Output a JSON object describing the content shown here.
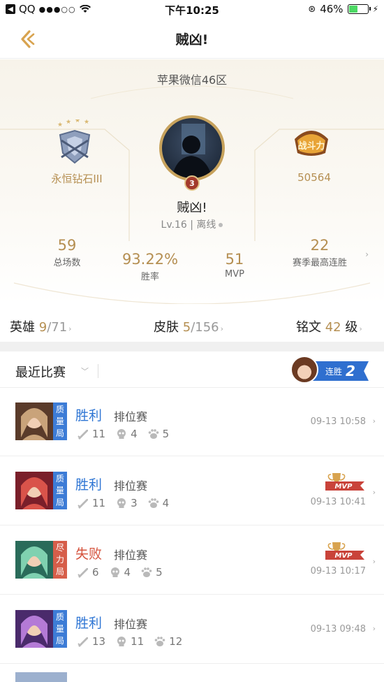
{
  "status": {
    "carrier": "QQ",
    "time": "下午10:25",
    "battery": "46%",
    "battery_level": 0.46
  },
  "nav": {
    "title": "贼凶!"
  },
  "profile": {
    "server": "苹果微信46区",
    "rank": "永恒钻石III",
    "combat_power": "50564",
    "name": "贼凶!",
    "level_text": "Lv.16 | 离线",
    "avatar_badge": "3",
    "stats": [
      {
        "num": "59",
        "label": "总场数"
      },
      {
        "num": "93.22%",
        "label": "胜率"
      },
      {
        "num": "51",
        "label": "MVP"
      },
      {
        "num": "22",
        "label": "赛季最高连胜"
      }
    ]
  },
  "summary": {
    "heroes_label": "英雄",
    "heroes_owned": "9",
    "heroes_total": "/71",
    "skins_label": "皮肤",
    "skins_owned": "5",
    "skins_total": "/156",
    "rune_label": "铭文",
    "rune_level": "42",
    "rune_unit": "级"
  },
  "recent": {
    "title": "最近比赛",
    "streak_label": "连胜",
    "streak_count": "2"
  },
  "matches": [
    {
      "result": "胜利",
      "mode": "排位赛",
      "tag": "质量局",
      "kills": "11",
      "deaths": "4",
      "assists": "5",
      "time": "09-13 10:58",
      "mvp": false,
      "win": true
    },
    {
      "result": "胜利",
      "mode": "排位赛",
      "tag": "质量局",
      "kills": "11",
      "deaths": "3",
      "assists": "4",
      "time": "09-13 10:41",
      "mvp": true,
      "win": true
    },
    {
      "result": "失败",
      "mode": "排位赛",
      "tag": "尽力局",
      "kills": "6",
      "deaths": "4",
      "assists": "5",
      "time": "09-13 10:17",
      "mvp": true,
      "win": false
    },
    {
      "result": "胜利",
      "mode": "排位赛",
      "tag": "质量局",
      "kills": "13",
      "deaths": "11",
      "assists": "12",
      "time": "09-13 09:48",
      "mvp": false,
      "win": true
    }
  ],
  "mvp_label": "MVP",
  "colors": {
    "gold": "#b58f52",
    "win": "#2f76d4",
    "lose": "#d5533d",
    "tag_blue": "#3d7cd6",
    "tag_red": "#d65e4a"
  }
}
